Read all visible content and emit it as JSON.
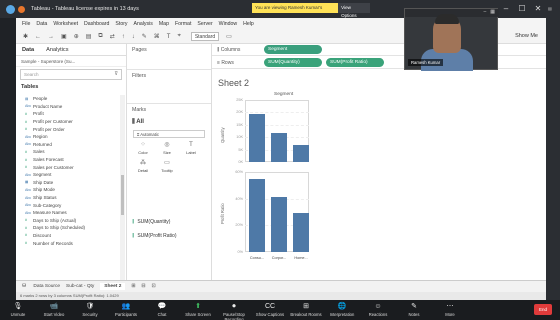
{
  "window": {
    "title": "Tableau - Tableau license expires in 13 days",
    "share_banner": "You are viewing Ramesh Kumar's screen",
    "view_options": "View Options"
  },
  "menu": [
    "File",
    "Data",
    "Worksheet",
    "Dashboard",
    "Story",
    "Analysis",
    "Map",
    "Format",
    "Server",
    "Window",
    "Help"
  ],
  "toolbar": {
    "standard": "Standard",
    "show_me": "Show Me"
  },
  "data_pane": {
    "tab_data": "Data",
    "tab_analytics": "Analytics",
    "source": "Sample - Superstore (Su...",
    "search_placeholder": "Search",
    "tables_label": "Tables",
    "fields": [
      {
        "name": "People",
        "kind": "dimension",
        "icon": "table-icon"
      },
      {
        "name": "Product Name",
        "kind": "dimension",
        "icon": "abc-icon"
      },
      {
        "name": "Profit",
        "kind": "measure",
        "icon": "hash-icon"
      },
      {
        "name": "Profit per Customer",
        "kind": "measure",
        "icon": "hash-icon"
      },
      {
        "name": "Profit per Order",
        "kind": "measure",
        "icon": "hash-icon"
      },
      {
        "name": "Region",
        "kind": "dimension",
        "icon": "abc-icon"
      },
      {
        "name": "Returned",
        "kind": "dimension",
        "icon": "abc-icon"
      },
      {
        "name": "Sales",
        "kind": "measure",
        "icon": "hash-icon"
      },
      {
        "name": "Sales Forecast",
        "kind": "measure",
        "icon": "hash-icon"
      },
      {
        "name": "Sales per Customer",
        "kind": "measure",
        "icon": "hash-icon"
      },
      {
        "name": "Segment",
        "kind": "dimension",
        "icon": "abc-icon"
      },
      {
        "name": "Ship Date",
        "kind": "dimension",
        "icon": "calendar-icon"
      },
      {
        "name": "Ship Mode",
        "kind": "dimension",
        "icon": "abc-icon"
      },
      {
        "name": "Ship Status",
        "kind": "dimension",
        "icon": "abc-icon"
      },
      {
        "name": "Sub-Category",
        "kind": "dimension",
        "icon": "abc-icon"
      },
      {
        "name": "Measure Names",
        "kind": "dimension",
        "icon": "abc-icon"
      },
      {
        "name": "Days to Ship (Actual)",
        "kind": "measure",
        "icon": "hash-icon"
      },
      {
        "name": "Days to Ship (Scheduled)",
        "kind": "measure",
        "icon": "hash-icon"
      },
      {
        "name": "Discount",
        "kind": "measure",
        "icon": "hash-icon"
      },
      {
        "name": "Number of Records",
        "kind": "measure",
        "icon": "hash-icon"
      }
    ]
  },
  "shelves": {
    "pages": "Pages",
    "filters": "Filters",
    "marks": "Marks",
    "marks_all": "All",
    "marks_type": "Automatic",
    "mark_buttons": [
      "Color",
      "Size",
      "Label",
      "Detail",
      "Tooltip"
    ],
    "marks_pills": [
      "SUM(Quantity)",
      "SUM(Profit Ratio)"
    ],
    "columns_label": "Columns",
    "rows_label": "Rows",
    "columns_pills": [
      "Segment"
    ],
    "rows_pills": [
      "SUM(Quantity)",
      "SUM(Profit Ratio)"
    ]
  },
  "sheet": {
    "title": "Sheet 2",
    "header": "Segment",
    "ylabel_top": "Quantity",
    "ylabel_bottom": "Profit Ratio",
    "ticks_top": [
      "25K",
      "20K",
      "15K",
      "10K",
      "5K",
      "0K"
    ],
    "ticks_bottom": [
      "60%",
      "40%",
      "20%",
      "0%"
    ],
    "categories": [
      "Consu...",
      "Corpor...",
      "Home..."
    ]
  },
  "chart_data": [
    {
      "type": "bar",
      "categories": [
        "Consumer",
        "Corporate",
        "Home Office"
      ],
      "values": [
        19500,
        11600,
        7000
      ],
      "ylabel": "Quantity",
      "ylim": [
        0,
        25000
      ]
    },
    {
      "type": "bar",
      "categories": [
        "Consumer",
        "Corporate",
        "Home Office"
      ],
      "values": [
        0.64,
        0.48,
        0.34
      ],
      "ylabel": "Profit Ratio",
      "ylim": [
        0,
        0.7
      ]
    }
  ],
  "bottom": {
    "data_source": "Data Source",
    "tabs": [
      "Sub-cat - Qty",
      "Sheet 2"
    ],
    "status": "6 marks    2 rows by 3 columns    SUM(Profit Ratio): 1.0429"
  },
  "webcam": {
    "name": "Ramesh Kumar"
  },
  "zoom_bar": {
    "items": [
      "Unmute",
      "Start Video",
      "Security",
      "Participants",
      "Chat",
      "Share Screen",
      "Pause/Stop Recording",
      "Show Captions",
      "Breakout Rooms",
      "Interpretation",
      "Reactions",
      "Notes",
      "More"
    ],
    "end": "End"
  },
  "colors": {
    "bar": "#4e79a7",
    "pill": "#3fb08b",
    "banner": "#ffe257",
    "end": "#e03b3b"
  }
}
